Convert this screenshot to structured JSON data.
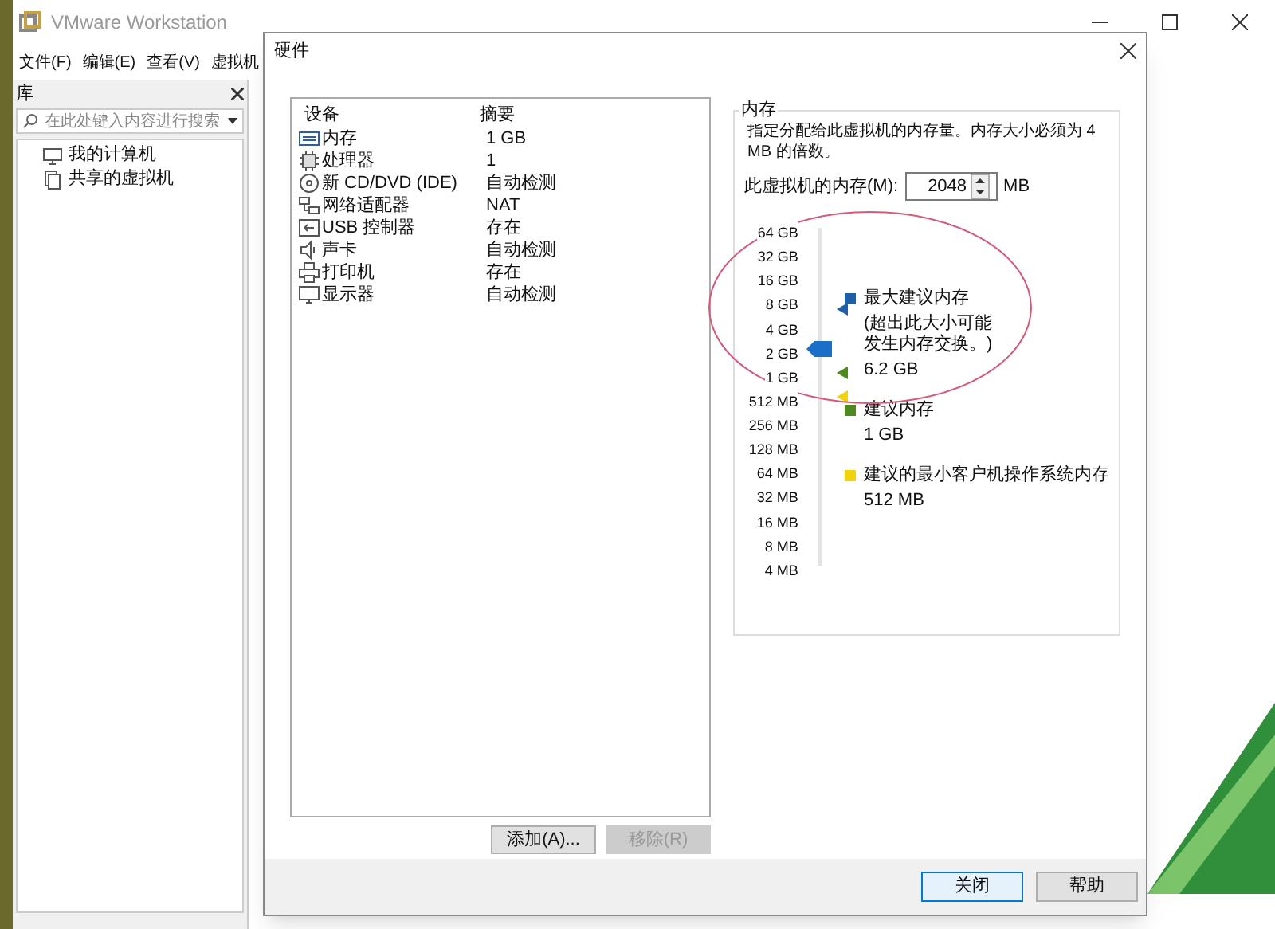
{
  "main_window": {
    "title": "VMware Workstation",
    "menu": [
      "文件(F)",
      "编辑(E)",
      "查看(V)",
      "虚拟机"
    ],
    "library": {
      "title": "库",
      "search": {
        "placeholder": "在此处键入内容进行搜索"
      },
      "items": [
        {
          "label": "我的计算机",
          "kind": "computer"
        },
        {
          "label": "共享的虚拟机",
          "kind": "shared"
        }
      ]
    }
  },
  "dialog": {
    "title": "硬件",
    "table": {
      "columns": [
        "设备",
        "摘要"
      ],
      "rows": [
        {
          "kind": "memory",
          "device": "内存",
          "summary": "1 GB"
        },
        {
          "kind": "cpu",
          "device": "处理器",
          "summary": "1"
        },
        {
          "kind": "cdrom",
          "device": "新 CD/DVD (IDE)",
          "summary": "自动检测"
        },
        {
          "kind": "network",
          "device": "网络适配器",
          "summary": "NAT"
        },
        {
          "kind": "usb",
          "device": "USB 控制器",
          "summary": "存在"
        },
        {
          "kind": "sound",
          "device": "声卡",
          "summary": "自动检测"
        },
        {
          "kind": "printer",
          "device": "打印机",
          "summary": "存在"
        },
        {
          "kind": "display",
          "device": "显示器",
          "summary": "自动检测"
        }
      ]
    },
    "add_button": {
      "label": "添加(A)...",
      "disabled": false
    },
    "remove_button": {
      "label": "移除(R)",
      "disabled": true
    },
    "memory": {
      "title": "内存",
      "description": "指定分配给此虚拟机的内存量。内存大小必须为 4 MB 的倍数。",
      "field_label": "此虚拟机的内存(M):",
      "value": "2048",
      "unit": "MB",
      "scale": [
        "64 GB",
        "32 GB",
        "16 GB",
        "8 GB",
        "4 GB",
        "2 GB",
        "1 GB",
        "512 MB",
        "256 MB",
        "128 MB",
        "64 MB",
        "32 MB",
        "16 MB",
        "8 MB",
        "4 MB"
      ],
      "slider": {
        "level": 0.643,
        "markers": [
          {
            "color": "#1f5fa8",
            "level": 0.76
          },
          {
            "color": "#4f8a1e",
            "level": 0.571
          },
          {
            "color": "#f2d20a",
            "level": 0.5
          }
        ]
      },
      "legend": [
        {
          "color": "#1f5fa8",
          "title": "最大建议内存",
          "note": "(超出此大小可能发生内存交换。)",
          "value": "6.2 GB"
        },
        {
          "color": "#4f8a1e",
          "title": "建议内存",
          "value": "1 GB"
        },
        {
          "color": "#f2d20a",
          "title": "建议的最小客户机操作系统内存",
          "value": "512 MB"
        }
      ]
    },
    "buttons": [
      {
        "label": "关闭",
        "focused": true
      },
      {
        "label": "帮助",
        "focused": false
      }
    ]
  }
}
